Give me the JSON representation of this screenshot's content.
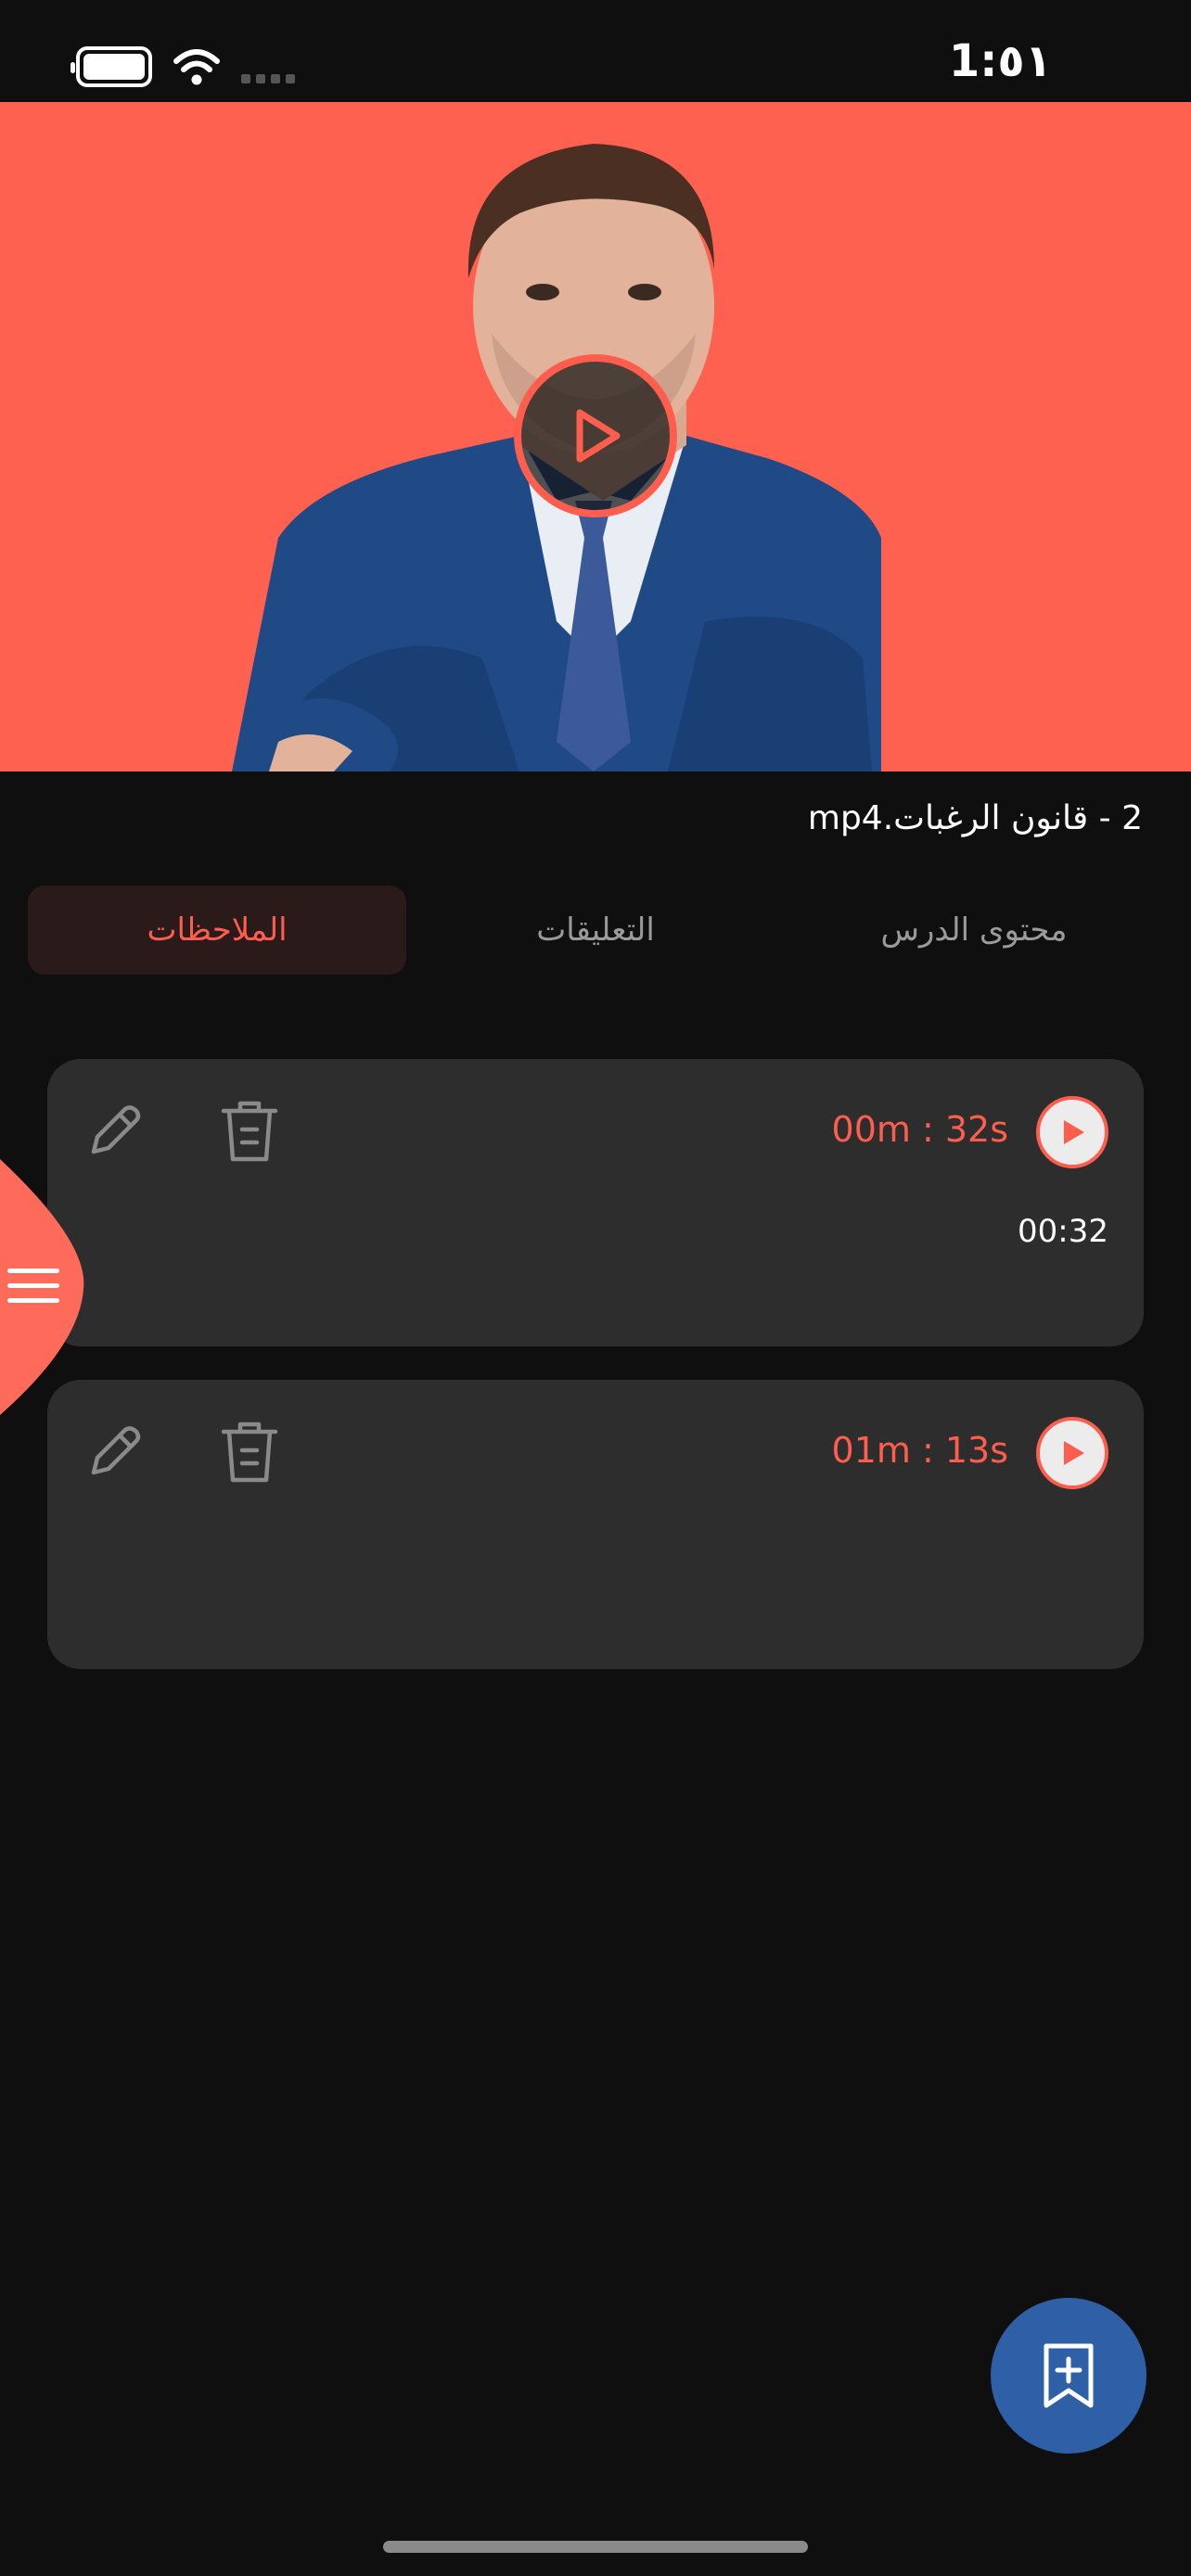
{
  "status_bar": {
    "time": "1:٥١"
  },
  "video": {
    "title": "2 - قانون الرغبات.mp4"
  },
  "tabs": [
    {
      "label": "محتوى الدرس",
      "active": false
    },
    {
      "label": "التعليقات",
      "active": false
    },
    {
      "label": "الملاحظات",
      "active": true
    }
  ],
  "notes": [
    {
      "timestamp": "00m : 32s",
      "text": "00:32"
    },
    {
      "timestamp": "01m : 13s",
      "text": ""
    }
  ],
  "colors": {
    "accent": "#ff5e4e",
    "video_bg": "#ff6150",
    "card_bg": "#2d2d2d",
    "fab": "#2e5fa7",
    "background": "#0f0f0f"
  },
  "icons": {
    "play": "play-icon",
    "edit": "pencil-icon",
    "delete": "trash-icon",
    "menu": "hamburger-icon",
    "add_bookmark": "bookmark-add-icon"
  }
}
